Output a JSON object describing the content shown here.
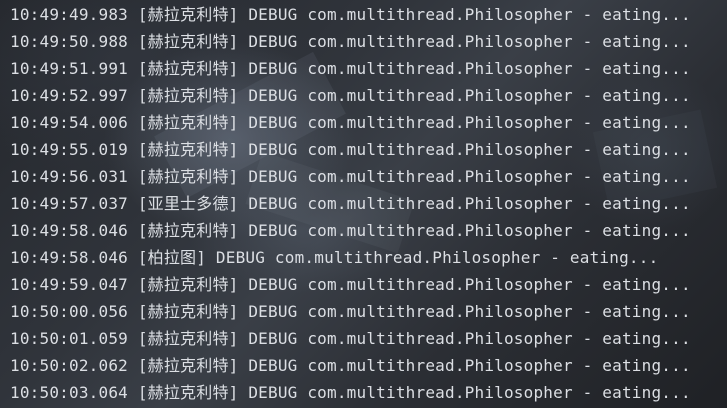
{
  "console": {
    "lines": [
      "10:49:49.983 [赫拉克利特] DEBUG com.multithread.Philosopher - eating...",
      "10:49:50.988 [赫拉克利特] DEBUG com.multithread.Philosopher - eating...",
      "10:49:51.991 [赫拉克利特] DEBUG com.multithread.Philosopher - eating...",
      "10:49:52.997 [赫拉克利特] DEBUG com.multithread.Philosopher - eating...",
      "10:49:54.006 [赫拉克利特] DEBUG com.multithread.Philosopher - eating...",
      "10:49:55.019 [赫拉克利特] DEBUG com.multithread.Philosopher - eating...",
      "10:49:56.031 [赫拉克利特] DEBUG com.multithread.Philosopher - eating...",
      "10:49:57.037 [亚里士多德] DEBUG com.multithread.Philosopher - eating...",
      "10:49:58.046 [赫拉克利特] DEBUG com.multithread.Philosopher - eating...",
      "10:49:58.046 [柏拉图] DEBUG com.multithread.Philosopher - eating...",
      "10:49:59.047 [赫拉克利特] DEBUG com.multithread.Philosopher - eating...",
      "10:50:00.056 [赫拉克利特] DEBUG com.multithread.Philosopher - eating...",
      "10:50:01.059 [赫拉克利特] DEBUG com.multithread.Philosopher - eating...",
      "10:50:02.062 [赫拉克利特] DEBUG com.multithread.Philosopher - eating...",
      "10:50:03.064 [赫拉克利特] DEBUG com.multithread.Philosopher - eating..."
    ]
  },
  "colors": {
    "text": "#dcdfe4",
    "background": "#2b2d31"
  }
}
